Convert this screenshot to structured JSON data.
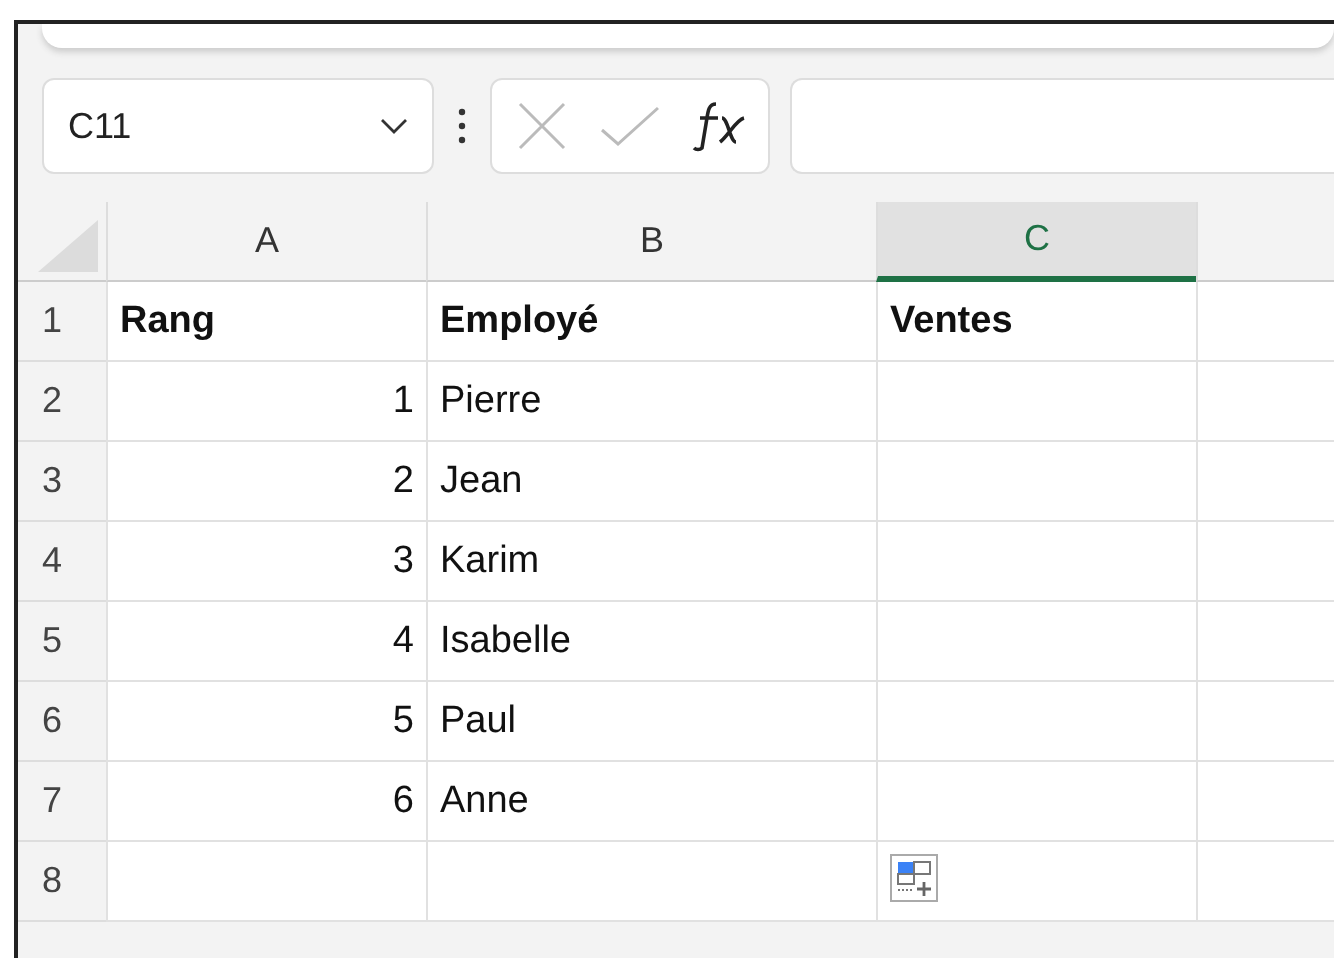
{
  "name_box": {
    "value": "C11"
  },
  "columns": [
    {
      "label": "A",
      "selected": false
    },
    {
      "label": "B",
      "selected": false
    },
    {
      "label": "C",
      "selected": true
    },
    {
      "selected": false
    }
  ],
  "rows": [
    {
      "number": "1",
      "cells": [
        "Rang",
        "Employé",
        "Ventes",
        null
      ],
      "kind": "header"
    },
    {
      "number": "2",
      "cells": [
        "1",
        "Pierre",
        null,
        null
      ],
      "kind": "data"
    },
    {
      "number": "3",
      "cells": [
        "2",
        "Jean",
        null,
        null
      ],
      "kind": "data"
    },
    {
      "number": "4",
      "cells": [
        "3",
        "Karim",
        null,
        null
      ],
      "kind": "data"
    },
    {
      "number": "5",
      "cells": [
        "4",
        "Isabelle",
        null,
        null
      ],
      "kind": "data"
    },
    {
      "number": "6",
      "cells": [
        "5",
        "Paul",
        null,
        null
      ],
      "kind": "data"
    },
    {
      "number": "7",
      "cells": [
        "6",
        "Anne",
        null,
        null
      ],
      "kind": "data"
    },
    {
      "number": "8",
      "cells": [
        null,
        null,
        null,
        null
      ],
      "kind": "data"
    }
  ]
}
